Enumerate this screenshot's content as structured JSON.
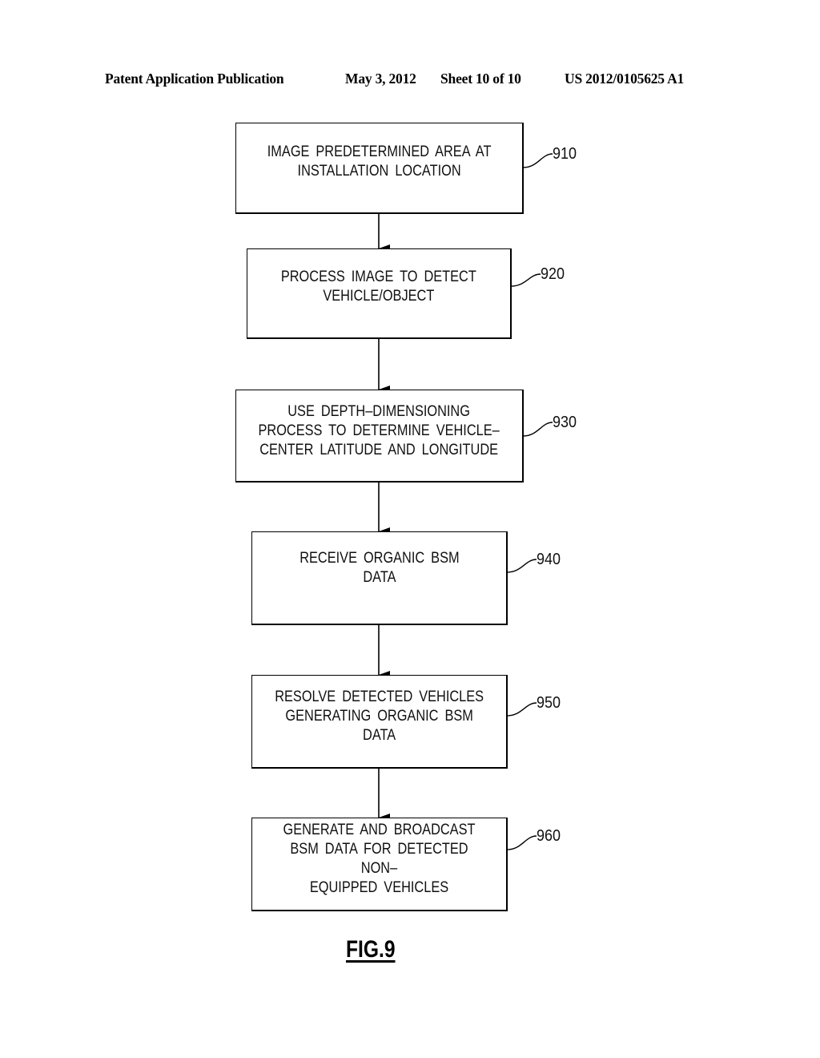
{
  "header": {
    "publication": "Patent Application Publication",
    "date": "May 3, 2012",
    "sheet": "Sheet 10 of 10",
    "number": "US 2012/0105625 A1"
  },
  "flowchart": {
    "steps": [
      {
        "ref": "910",
        "text": "IMAGE  PREDETERMINED  AREA  AT\nINSTALLATION  LOCATION"
      },
      {
        "ref": "920",
        "text": "PROCESS  IMAGE  TO  DETECT\nVEHICLE/OBJECT"
      },
      {
        "ref": "930",
        "text": "USE  DEPTH–DIMENSIONING\nPROCESS  TO  DETERMINE  VEHICLE–\nCENTER  LATITUDE  AND  LONGITUDE"
      },
      {
        "ref": "940",
        "text": "RECEIVE  ORGANIC  BSM\nDATA"
      },
      {
        "ref": "950",
        "text": "RESOLVE  DETECTED  VEHICLES\nGENERATING  ORGANIC  BSM\nDATA"
      },
      {
        "ref": "960",
        "text": "GENERATE  AND  BROADCAST\nBSM  DATA  FOR  DETECTED  NON–\nEQUIPPED  VEHICLES"
      }
    ]
  },
  "figure_label": "FIG.9"
}
